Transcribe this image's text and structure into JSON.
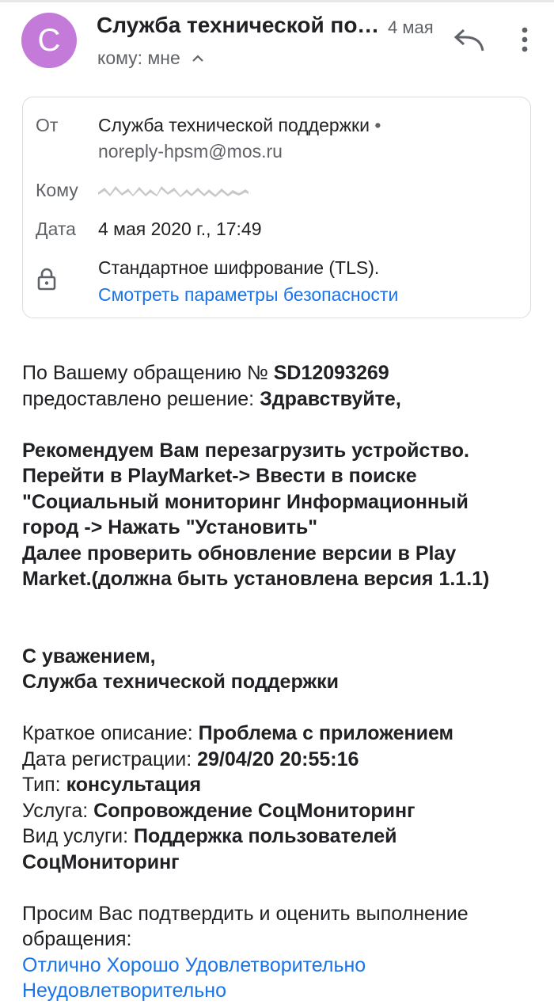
{
  "header": {
    "avatar_letter": "С",
    "sender": "Служба технической поддержки",
    "date_short": "4 мая",
    "to_line": "кому: мне"
  },
  "details": {
    "from_label": "От",
    "from_name": "Служба технической поддержки",
    "from_email": "noreply-hpsm@mos.ru",
    "to_label": "Кому",
    "date_label": "Дата",
    "date_value": "4 мая 2020 г., 17:49",
    "encryption": "Стандартное шифрование (TLS).",
    "security_link": "Смотреть параметры безопасности"
  },
  "message": {
    "intro": "По Вашему обращению №",
    "ticket": "SD12093269",
    "solution_label": "предоставлено решение:",
    "greeting": "Здравствуйте,",
    "rec1": "Рекомендуем Вам перезагрузить устройство.",
    "rec2": "Перейти в PlayMarket-> Ввести в поиске",
    "rec3": "\"Социальный мониторинг Информационный",
    "rec4": "город -> Нажать \"Установить\"",
    "rec5": "Далее проверить обновление версии в Play",
    "rec6": "Market.(должна быть установлена версия 1.1.1)",
    "regards": "С уважением,",
    "signature": "Служба технической поддержки",
    "fields": [
      {
        "label": "Краткое описание:",
        "value": "Проблема с приложением"
      },
      {
        "label": "Дата регистрации:",
        "value": "29/04/20 20:55:16"
      },
      {
        "label": "Тип:",
        "value": "консультация"
      },
      {
        "label": "Услуга:",
        "value": "Сопровождение СоцМониторинг"
      },
      {
        "label": "Вид услуги:",
        "value": "Поддержка пользователей",
        "value2": "СоцМониторинг"
      }
    ],
    "request": "Просим Вас подтвердить и оценить выполнение обращения:",
    "ratings": [
      "Отлично",
      "Хорошо",
      "Удовлетворительно",
      "Неудовлетворительно"
    ]
  },
  "colors": {
    "avatar": "#c47ad9",
    "link": "#1a73e8",
    "secondary_text": "#5f6368",
    "border": "#dadce0"
  },
  "icons": [
    "reply-icon",
    "more-vert-icon",
    "chevron-up-icon",
    "lock-icon"
  ]
}
